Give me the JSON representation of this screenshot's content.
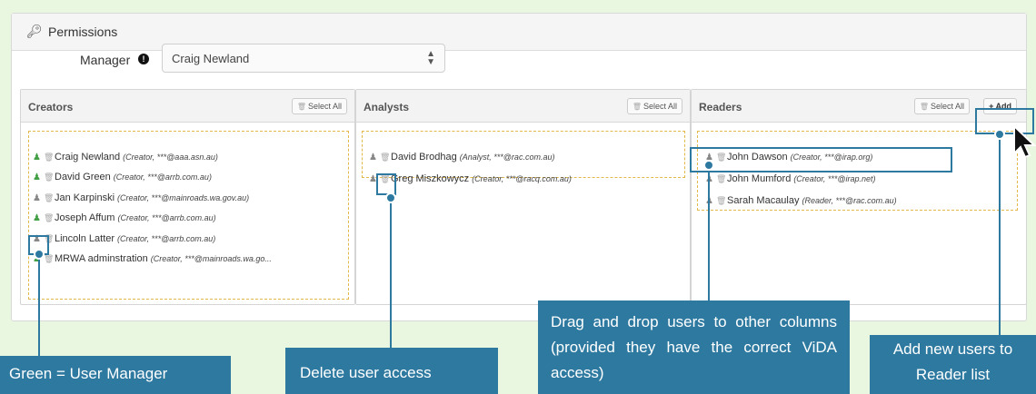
{
  "panel": {
    "title": "Permissions",
    "key_icon": "key-icon"
  },
  "manager": {
    "label": "Manager",
    "selected": "Craig Newland"
  },
  "columns": {
    "creators": {
      "title": "Creators",
      "select_all": "Select All",
      "users": [
        {
          "name": "Craig Newland",
          "detail": "(Creator, ***@aaa.asn.au)",
          "manager": true
        },
        {
          "name": "David Green",
          "detail": "(Creator, ***@arrb.com.au)",
          "manager": true
        },
        {
          "name": "Jan Karpinski",
          "detail": "(Creator, ***@mainroads.wa.gov.au)",
          "manager": false
        },
        {
          "name": "Joseph Affum",
          "detail": "(Creator, ***@arrb.com.au)",
          "manager": true
        },
        {
          "name": "Lincoln Latter",
          "detail": "(Creator, ***@arrb.com.au)",
          "manager": false
        },
        {
          "name": "MRWA adminstration",
          "detail": "(Creator, ***@mainroads.wa.go...",
          "manager": true
        }
      ]
    },
    "analysts": {
      "title": "Analysts",
      "select_all": "Select All",
      "users": [
        {
          "name": "David Brodhag",
          "detail": "(Analyst, ***@rac.com.au)",
          "manager": false
        },
        {
          "name": "Greg Miszkowycz",
          "detail": "(Creator, ***@racq.com.au)",
          "manager": false
        }
      ]
    },
    "readers": {
      "title": "Readers",
      "select_all": "Select All",
      "add": "+ Add",
      "users": [
        {
          "name": "John Dawson",
          "detail": "(Creator, ***@irap.org)",
          "manager": false
        },
        {
          "name": "John Mumford",
          "detail": "(Creator, ***@irap.net)",
          "manager": false
        },
        {
          "name": "Sarah Macaulay",
          "detail": "(Reader, ***@rac.com.au)",
          "manager": false
        }
      ]
    }
  },
  "callouts": {
    "green": "Green = User Manager",
    "delete": "Delete user access",
    "drag": "Drag and drop users to other columns (provided they have the correct ViDA access)",
    "add": "Add new users to Reader list"
  },
  "colors": {
    "callout": "#2e79a0",
    "background": "#e9f7e0",
    "manager_green": "#44a047",
    "drop_border": "#e3b84a"
  }
}
